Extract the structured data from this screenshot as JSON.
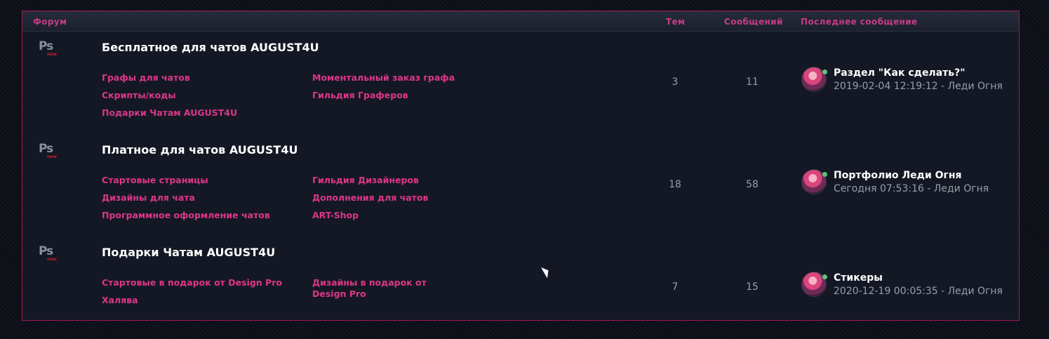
{
  "header": {
    "forum": "Форум",
    "topics": "Тем",
    "posts": "Сообщений",
    "last": "Последнее сообщение"
  },
  "icon": {
    "ps": "Ps",
    "new": "new",
    "name": "ps-new-icon"
  },
  "rows": [
    {
      "title": "Бесплатное для чатов AUGUST4U",
      "subforums": [
        "Графы для чатов",
        "Моментальный заказ графа",
        "Скрипты/коды",
        "Гильдия Граферов",
        "Подарки Чатам AUGUST4U"
      ],
      "topics": "3",
      "posts": "11",
      "last_title": "Раздел \"Как сделать?\"",
      "last_meta": "2019-02-04 12:19:12 - Леди Огня"
    },
    {
      "title": "Платное для чатов AUGUST4U",
      "subforums": [
        "Стартовые страницы",
        "Гильдия Дизайнеров",
        "Дизайны для чата",
        "Дополнения для чатов",
        "Программное оформление чатов",
        "ART-Shop"
      ],
      "topics": "18",
      "posts": "58",
      "last_title": "Портфолио Леди Огня",
      "last_meta": "Сегодня 07:53:16 - Леди Огня"
    },
    {
      "title": "Подарки Чатам AUGUST4U",
      "subforums": [
        "Стартовые в подарок от Design Pro",
        "Дизайны в подарок от",
        "Design Pro",
        "Халява"
      ],
      "topics": "7",
      "posts": "15",
      "last_title": "Стикеры",
      "last_meta": "2020-12-19 00:05:35 - Леди Огня"
    }
  ],
  "colors": {
    "accent": "#dd3688",
    "border": "#a3175e",
    "background": "#141824"
  }
}
